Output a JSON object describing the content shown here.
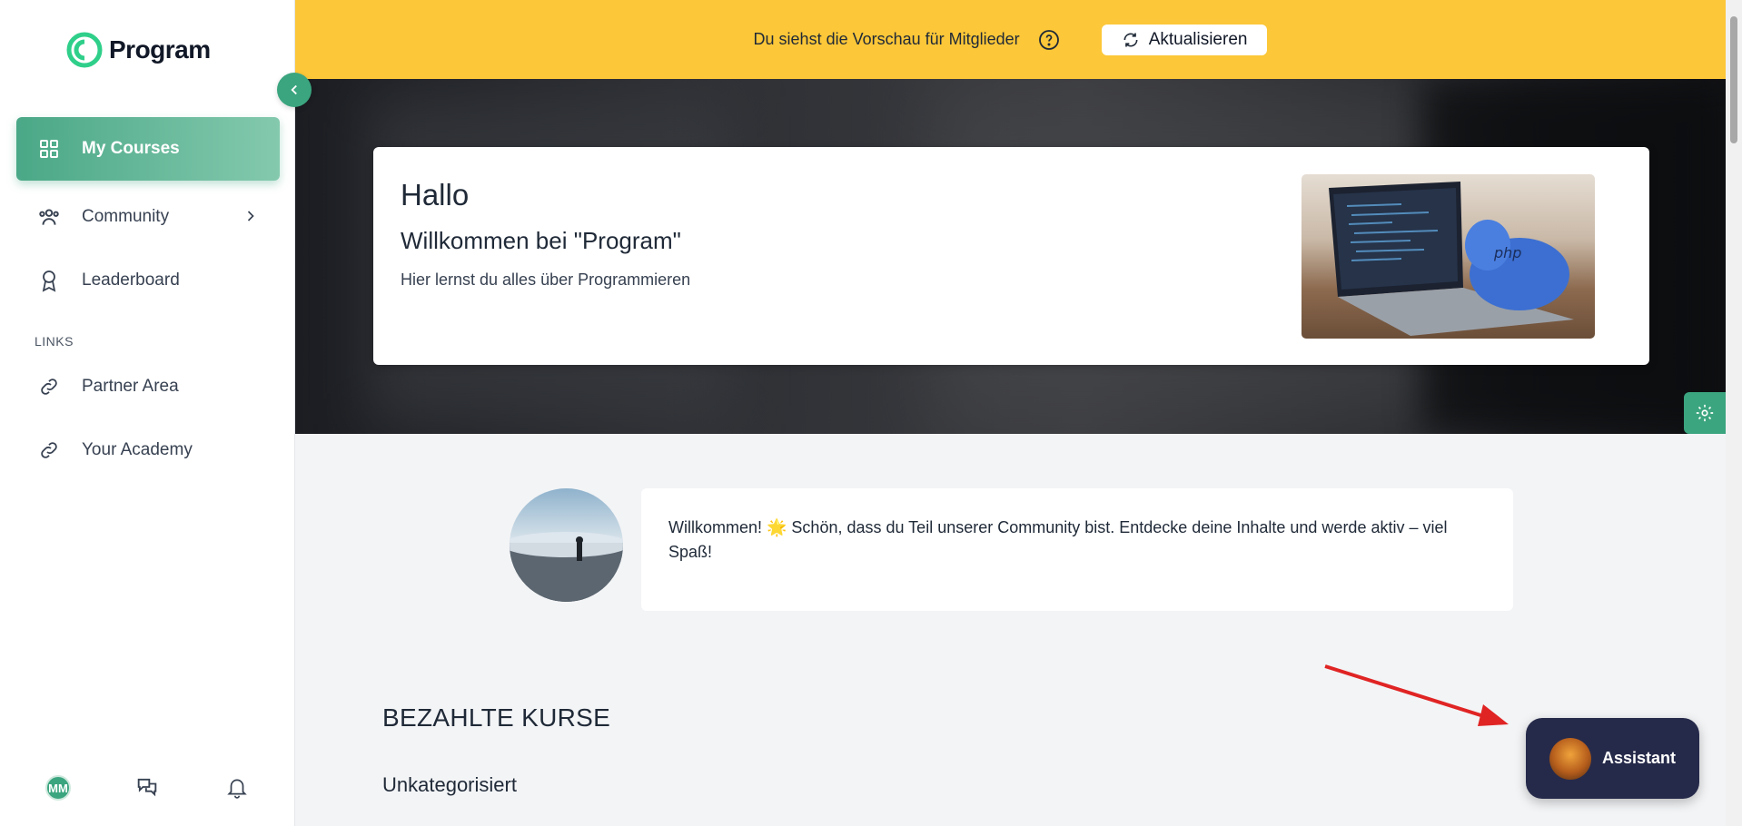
{
  "app": {
    "name": "Program"
  },
  "sidebar": {
    "items": [
      {
        "label": "My Courses",
        "icon": "grid-icon",
        "active": true
      },
      {
        "label": "Community",
        "icon": "users-icon",
        "expandable": true
      },
      {
        "label": "Leaderboard",
        "icon": "award-icon"
      }
    ],
    "links_label": "LINKS",
    "links": [
      {
        "label": "Partner Area",
        "icon": "link-icon"
      },
      {
        "label": "Your Academy",
        "icon": "link-icon"
      }
    ],
    "user_initials": "MM"
  },
  "banner": {
    "text": "Du siehst die Vorschau für Mitglieder",
    "refresh_label": "Aktualisieren"
  },
  "hero": {
    "title": "Hallo",
    "subtitle": "Willkommen bei \"Program\"",
    "description": "Hier lernst du alles über Programmieren"
  },
  "welcome": {
    "message": "Willkommen! 🌟 Schön, dass du Teil unserer Community bist. Entdecke deine Inhalte und werde aktiv – viel Spaß!"
  },
  "courses": {
    "section_title": "BEZAHLTE KURSE",
    "category": "Unkategorisiert"
  },
  "assistant": {
    "label": "Assistant"
  },
  "colors": {
    "accent": "#3ba57f",
    "banner": "#fcc738",
    "assistant_bg": "#262a4a"
  }
}
